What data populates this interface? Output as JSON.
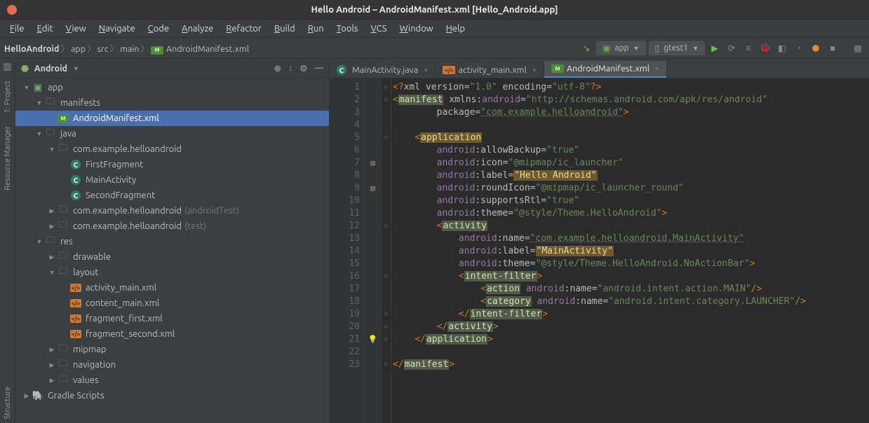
{
  "window": {
    "title": "Hello Android – AndroidManifest.xml [Hello_Android.app]"
  },
  "menu": [
    "File",
    "Edit",
    "View",
    "Navigate",
    "Code",
    "Analyze",
    "Refactor",
    "Build",
    "Run",
    "Tools",
    "VCS",
    "Window",
    "Help"
  ],
  "breadcrumbs": [
    "HelloAndroid",
    "app",
    "src",
    "main",
    "AndroidManifest.xml"
  ],
  "toolbar": {
    "run_config": "app",
    "device": "gtest1"
  },
  "left_stripe": [
    "1: Project",
    "Resource Manager",
    "Structure"
  ],
  "project": {
    "view_label": "Android",
    "tree": [
      {
        "d": 0,
        "ex": "down",
        "icon": "app",
        "label": "app"
      },
      {
        "d": 1,
        "ex": "down",
        "icon": "folder",
        "label": "manifests"
      },
      {
        "d": 2,
        "ex": "none",
        "icon": "xml-green",
        "label": "AndroidManifest.xml",
        "sel": true
      },
      {
        "d": 1,
        "ex": "down",
        "icon": "folder",
        "label": "java"
      },
      {
        "d": 2,
        "ex": "down",
        "icon": "pkg",
        "label": "com.example.helloandroid"
      },
      {
        "d": 3,
        "ex": "none",
        "icon": "class",
        "label": "FirstFragment"
      },
      {
        "d": 3,
        "ex": "none",
        "icon": "class",
        "label": "MainActivity"
      },
      {
        "d": 3,
        "ex": "none",
        "icon": "class",
        "label": "SecondFragment"
      },
      {
        "d": 2,
        "ex": "right",
        "icon": "pkg",
        "label": "com.example.helloandroid",
        "dim": "(androidTest)"
      },
      {
        "d": 2,
        "ex": "right",
        "icon": "pkg",
        "label": "com.example.helloandroid",
        "dim": "(test)"
      },
      {
        "d": 1,
        "ex": "down",
        "icon": "res",
        "label": "res"
      },
      {
        "d": 2,
        "ex": "right",
        "icon": "folder",
        "label": "drawable"
      },
      {
        "d": 2,
        "ex": "down",
        "icon": "folder",
        "label": "layout"
      },
      {
        "d": 3,
        "ex": "none",
        "icon": "xml",
        "label": "activity_main.xml"
      },
      {
        "d": 3,
        "ex": "none",
        "icon": "xml",
        "label": "content_main.xml"
      },
      {
        "d": 3,
        "ex": "none",
        "icon": "xml",
        "label": "fragment_first.xml"
      },
      {
        "d": 3,
        "ex": "none",
        "icon": "xml",
        "label": "fragment_second.xml"
      },
      {
        "d": 2,
        "ex": "right",
        "icon": "folder",
        "label": "mipmap"
      },
      {
        "d": 2,
        "ex": "right",
        "icon": "folder",
        "label": "navigation"
      },
      {
        "d": 2,
        "ex": "right",
        "icon": "folder",
        "label": "values"
      },
      {
        "d": 0,
        "ex": "right",
        "icon": "gradle",
        "label": "Gradle Scripts"
      }
    ]
  },
  "tabs": [
    {
      "icon": "class",
      "label": "MainActivity.java",
      "active": false
    },
    {
      "icon": "xml",
      "label": "activity_main.xml",
      "active": false
    },
    {
      "icon": "xml-green",
      "label": "AndroidManifest.xml",
      "active": true
    }
  ],
  "editor": {
    "gutter_extras": {
      "7": "img",
      "9": "img",
      "21": "bulb"
    },
    "fold": {
      "1": "–",
      "2": "–",
      "5": "–",
      "12": "–",
      "16": "–",
      "19": "–",
      "20": "–",
      "21": "–",
      "23": "–"
    },
    "lines": [
      {
        "n": 1,
        "segs": [
          {
            "t": "<?",
            "c": "kw"
          },
          {
            "t": "xml version",
            "c": "attr"
          },
          {
            "t": "=",
            "c": "p"
          },
          {
            "t": "\"1.0\"",
            "c": "val"
          },
          {
            "t": " encoding",
            "c": "attr"
          },
          {
            "t": "=",
            "c": "p"
          },
          {
            "t": "\"utf-8\"",
            "c": "val"
          },
          {
            "t": "?>",
            "c": "kw"
          }
        ]
      },
      {
        "n": 2,
        "segs": [
          {
            "t": "<",
            "c": "kw"
          },
          {
            "t": "manifest",
            "c": "hl-pale"
          },
          {
            "t": " ",
            "c": "p"
          },
          {
            "t": "xmlns:",
            "c": "attr"
          },
          {
            "t": "android",
            "c": "ns"
          },
          {
            "t": "=",
            "c": "p"
          },
          {
            "t": "\"http://schemas.android.com/apk/res/android\"",
            "c": "val"
          }
        ]
      },
      {
        "n": 3,
        "indent": 4,
        "segs": [
          {
            "t": "package",
            "c": "attr"
          },
          {
            "t": "=",
            "c": "p"
          },
          {
            "t": "\"com.example.helloandroid\"",
            "c": "link"
          },
          {
            "t": ">",
            "c": "kw"
          }
        ]
      },
      {
        "n": 4,
        "segs": []
      },
      {
        "n": 5,
        "indent": 2,
        "segs": [
          {
            "t": "<",
            "c": "kw"
          },
          {
            "t": "application",
            "c": "hl-amber"
          }
        ]
      },
      {
        "n": 6,
        "indent": 4,
        "segs": [
          {
            "t": "android",
            "c": "ns"
          },
          {
            "t": ":allowBackup",
            "c": "attr"
          },
          {
            "t": "=",
            "c": "p"
          },
          {
            "t": "\"true\"",
            "c": "val"
          }
        ]
      },
      {
        "n": 7,
        "indent": 4,
        "segs": [
          {
            "t": "android",
            "c": "ns"
          },
          {
            "t": ":icon",
            "c": "attr"
          },
          {
            "t": "=",
            "c": "p"
          },
          {
            "t": "\"@mipmap/ic_launcher\"",
            "c": "val"
          }
        ]
      },
      {
        "n": 8,
        "indent": 4,
        "segs": [
          {
            "t": "android",
            "c": "ns"
          },
          {
            "t": ":label",
            "c": "attr"
          },
          {
            "t": "=",
            "c": "p"
          },
          {
            "t": "\"Hello Android\"",
            "c": "hl-amber"
          }
        ]
      },
      {
        "n": 9,
        "indent": 4,
        "segs": [
          {
            "t": "android",
            "c": "ns"
          },
          {
            "t": ":roundIcon",
            "c": "attr"
          },
          {
            "t": "=",
            "c": "p"
          },
          {
            "t": "\"@mipmap/ic_launcher_round\"",
            "c": "val"
          }
        ]
      },
      {
        "n": 10,
        "indent": 4,
        "segs": [
          {
            "t": "android",
            "c": "ns"
          },
          {
            "t": ":supportsRtl",
            "c": "attr"
          },
          {
            "t": "=",
            "c": "p"
          },
          {
            "t": "\"true\"",
            "c": "val"
          }
        ]
      },
      {
        "n": 11,
        "indent": 4,
        "segs": [
          {
            "t": "android",
            "c": "ns"
          },
          {
            "t": ":theme",
            "c": "attr"
          },
          {
            "t": "=",
            "c": "p"
          },
          {
            "t": "\"@style/Theme.HelloAndroid\"",
            "c": "val"
          },
          {
            "t": ">",
            "c": "kw"
          }
        ]
      },
      {
        "n": 12,
        "indent": 4,
        "segs": [
          {
            "t": "<",
            "c": "kw"
          },
          {
            "t": "activity",
            "c": "hl-pale"
          }
        ]
      },
      {
        "n": 13,
        "indent": 6,
        "segs": [
          {
            "t": "android",
            "c": "ns"
          },
          {
            "t": ":name",
            "c": "attr"
          },
          {
            "t": "=",
            "c": "p"
          },
          {
            "t": "\"com.example.helloandroid.MainActivity\"",
            "c": "link"
          }
        ]
      },
      {
        "n": 14,
        "indent": 6,
        "segs": [
          {
            "t": "android",
            "c": "ns"
          },
          {
            "t": ":label",
            "c": "attr"
          },
          {
            "t": "=",
            "c": "p"
          },
          {
            "t": "\"MainActivity\"",
            "c": "hl-amber"
          }
        ]
      },
      {
        "n": 15,
        "indent": 6,
        "segs": [
          {
            "t": "android",
            "c": "ns"
          },
          {
            "t": ":theme",
            "c": "attr"
          },
          {
            "t": "=",
            "c": "p"
          },
          {
            "t": "\"@style/Theme.HelloAndroid.NoActionBar\"",
            "c": "val"
          },
          {
            "t": ">",
            "c": "kw"
          }
        ]
      },
      {
        "n": 16,
        "indent": 6,
        "segs": [
          {
            "t": "<",
            "c": "kw"
          },
          {
            "t": "intent-filter",
            "c": "hl-pale"
          },
          {
            "t": ">",
            "c": "kw"
          }
        ]
      },
      {
        "n": 17,
        "indent": 8,
        "segs": [
          {
            "t": "<",
            "c": "kw"
          },
          {
            "t": "action",
            "c": "hl-pale"
          },
          {
            "t": " ",
            "c": "p"
          },
          {
            "t": "android",
            "c": "ns"
          },
          {
            "t": ":name",
            "c": "attr"
          },
          {
            "t": "=",
            "c": "p"
          },
          {
            "t": "\"android.intent.action.MAIN\"",
            "c": "val"
          },
          {
            "t": "/>",
            "c": "kw"
          }
        ]
      },
      {
        "n": 18,
        "indent": 8,
        "segs": [
          {
            "t": "<",
            "c": "kw"
          },
          {
            "t": "category",
            "c": "hl-pale"
          },
          {
            "t": " ",
            "c": "p"
          },
          {
            "t": "android",
            "c": "ns"
          },
          {
            "t": ":name",
            "c": "attr"
          },
          {
            "t": "=",
            "c": "p"
          },
          {
            "t": "\"android.intent.category.LAUNCHER\"",
            "c": "val"
          },
          {
            "t": "/>",
            "c": "kw"
          }
        ]
      },
      {
        "n": 19,
        "indent": 6,
        "segs": [
          {
            "t": "</",
            "c": "kw"
          },
          {
            "t": "intent-filter",
            "c": "hl-pale"
          },
          {
            "t": ">",
            "c": "kw"
          }
        ]
      },
      {
        "n": 20,
        "indent": 4,
        "segs": [
          {
            "t": "</",
            "c": "kw"
          },
          {
            "t": "activity",
            "c": "hl-pale"
          },
          {
            "t": ">",
            "c": "kw"
          }
        ]
      },
      {
        "n": 21,
        "indent": 2,
        "segs": [
          {
            "t": "</",
            "c": "kw"
          },
          {
            "t": "application",
            "c": "hl-pale"
          },
          {
            "t": ">",
            "c": "kw"
          }
        ]
      },
      {
        "n": 22,
        "segs": []
      },
      {
        "n": 23,
        "segs": [
          {
            "t": "</",
            "c": "kw"
          },
          {
            "t": "manifest",
            "c": "hl-pale"
          },
          {
            "t": ">",
            "c": "kw"
          }
        ]
      }
    ]
  }
}
